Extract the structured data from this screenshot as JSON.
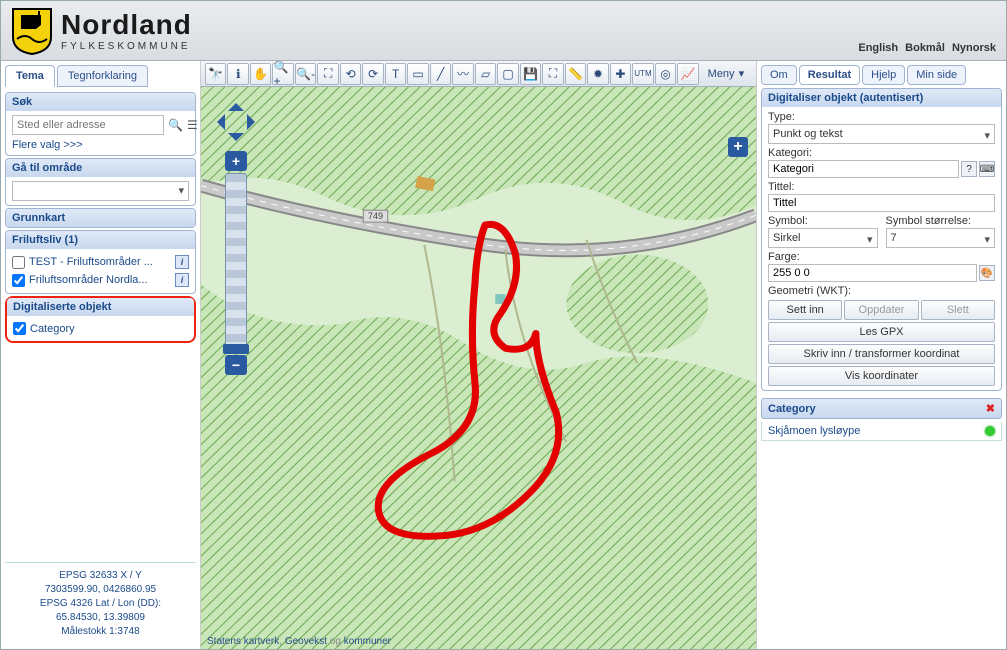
{
  "header": {
    "title": "Nordland",
    "subtitle": "FYLKESKOMMUNE",
    "languages": [
      "English",
      "Bokmål",
      "Nynorsk"
    ]
  },
  "left": {
    "tabs": {
      "tema": "Tema",
      "tegn": "Tegnforklaring"
    },
    "sok": {
      "title": "Søk",
      "placeholder": "Sted eller adresse",
      "more": "Flere valg >>>"
    },
    "omrade": {
      "title": "Gå til område"
    },
    "grunnkart": {
      "title": "Grunnkart"
    },
    "friluftsliv": {
      "title": "Friluftsliv (1)",
      "layers": [
        {
          "checked": false,
          "label": "TEST - Friluftsområder ..."
        },
        {
          "checked": true,
          "label": "Friluftsområder Nordla..."
        }
      ]
    },
    "digitaliserte": {
      "title": "Digitaliserte objekt",
      "layers": [
        {
          "checked": true,
          "label": "Category"
        }
      ]
    },
    "coords": {
      "epsg32633_label": "EPSG 32633 X / Y",
      "epsg32633_value": "7303599.90, 0426860.95",
      "epsg4326_label": "EPSG 4326 Lat / Lon (DD):",
      "epsg4326_value": "65.84530, 13.39809",
      "scale": "Målestokk 1:3748"
    }
  },
  "map": {
    "road_label": "749",
    "attribution_1": "Statens kartverk",
    "attribution_sep": ", ",
    "attribution_2": "Geovekst",
    "attribution_og": " og ",
    "attribution_3": "kommuner",
    "menu": "Meny"
  },
  "right": {
    "tabs": {
      "om": "Om",
      "resultat": "Resultat",
      "hjelp": "Hjelp",
      "minside": "Min side"
    },
    "panel_title": "Digitaliser objekt (autentisert)",
    "type_label": "Type:",
    "type_value": "Punkt og tekst",
    "kategori_label": "Kategori:",
    "kategori_value": "Kategori",
    "tittel_label": "Tittel:",
    "tittel_value": "Tittel",
    "symbol_label": "Symbol:",
    "symbol_value": "Sirkel",
    "symbol_size_label": "Symbol størrelse:",
    "symbol_size_value": "7",
    "farge_label": "Farge:",
    "farge_value": "255 0 0",
    "geom_label": "Geometri (WKT):",
    "buttons": {
      "sett_inn": "Sett inn",
      "oppdater": "Oppdater",
      "slett": "Slett",
      "les_gpx": "Les GPX",
      "skriv_inn": "Skriv inn / transformer koordinat",
      "vis_koord": "Vis koordinater"
    },
    "category_header": "Category",
    "category_item": "Skjåmoen lysløype"
  }
}
